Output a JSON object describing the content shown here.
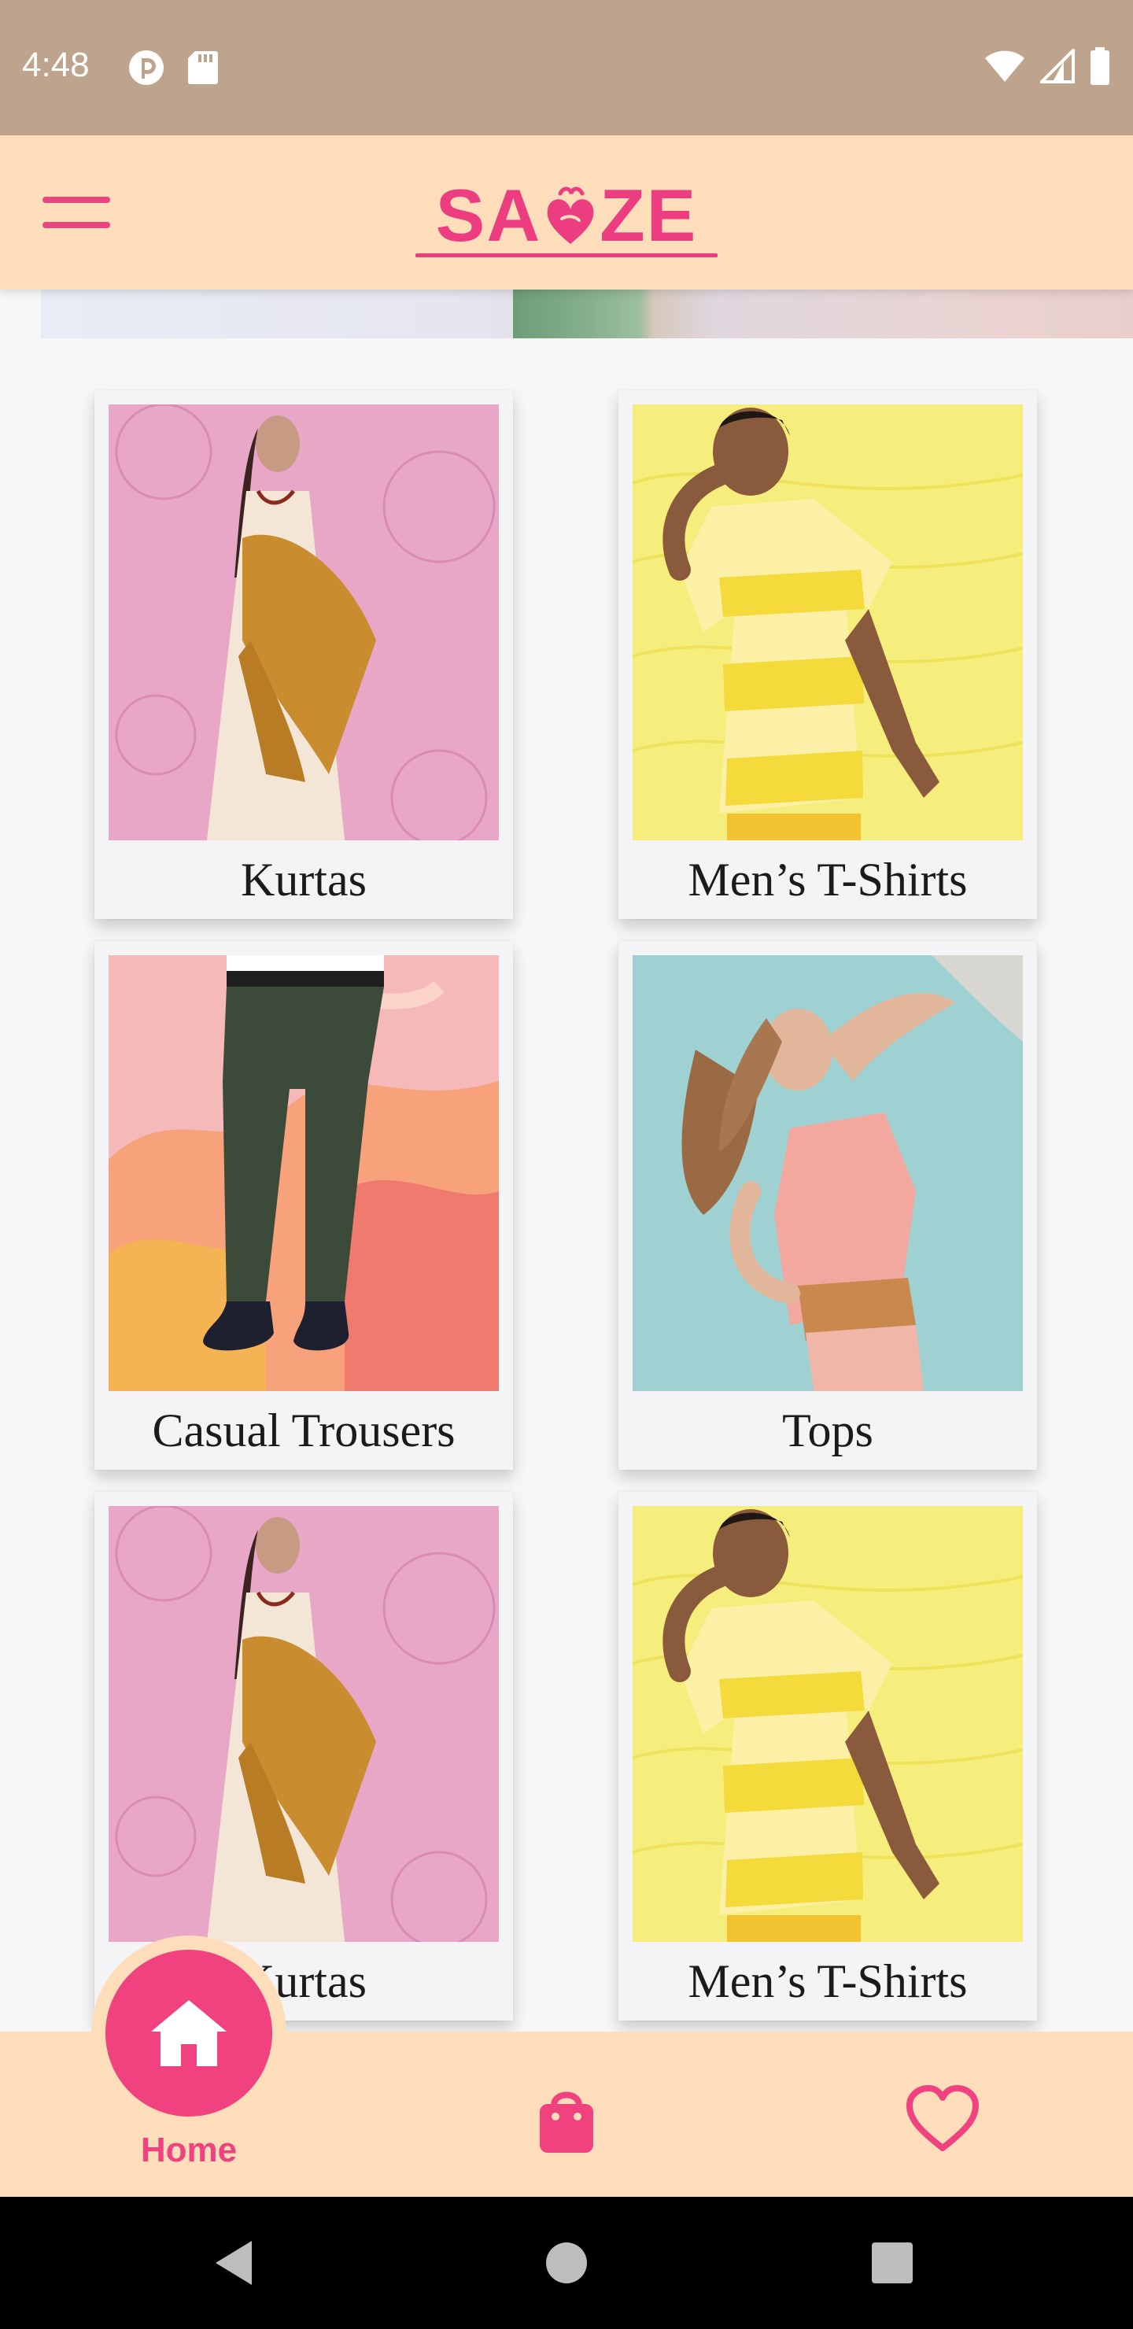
{
  "status_bar": {
    "time": "4:48",
    "background": "#BFA48D",
    "left_icons": [
      "pocket-casts-icon",
      "sd-card-icon"
    ],
    "right_icons": [
      "wifi-icon",
      "cellular-signal-icon",
      "battery-icon"
    ]
  },
  "header": {
    "logo_text": "SAZE",
    "logo_left": "SA",
    "logo_right": "ZE",
    "logo_mark": "heart-monogram-icon",
    "menu_icon": "hamburger-menu-icon",
    "background": "#FEDDBB",
    "accent": "#EB3D80"
  },
  "banner": {
    "description_icon": "promo-banner"
  },
  "categories": [
    {
      "label": "Kurtas",
      "theme": "pink"
    },
    {
      "label": "Men’s T-Shirts",
      "theme": "yellow"
    },
    {
      "label": "Casual Trousers",
      "theme": "peach"
    },
    {
      "label": "Tops",
      "theme": "teal"
    },
    {
      "label": "Kurtas",
      "theme": "pink"
    },
    {
      "label": "Men’s T-Shirts",
      "theme": "yellow"
    }
  ],
  "bottom_nav": {
    "home_label": "Home",
    "home_icon": "home-icon",
    "bag_icon": "shopping-bag-icon",
    "wishlist_icon": "heart-outline-icon",
    "active_color": "#F0427F",
    "background": "#FEDDBB"
  },
  "system_nav": {
    "back_icon": "back-triangle-icon",
    "home_icon": "home-circle-icon",
    "recents_icon": "recents-square-icon"
  }
}
